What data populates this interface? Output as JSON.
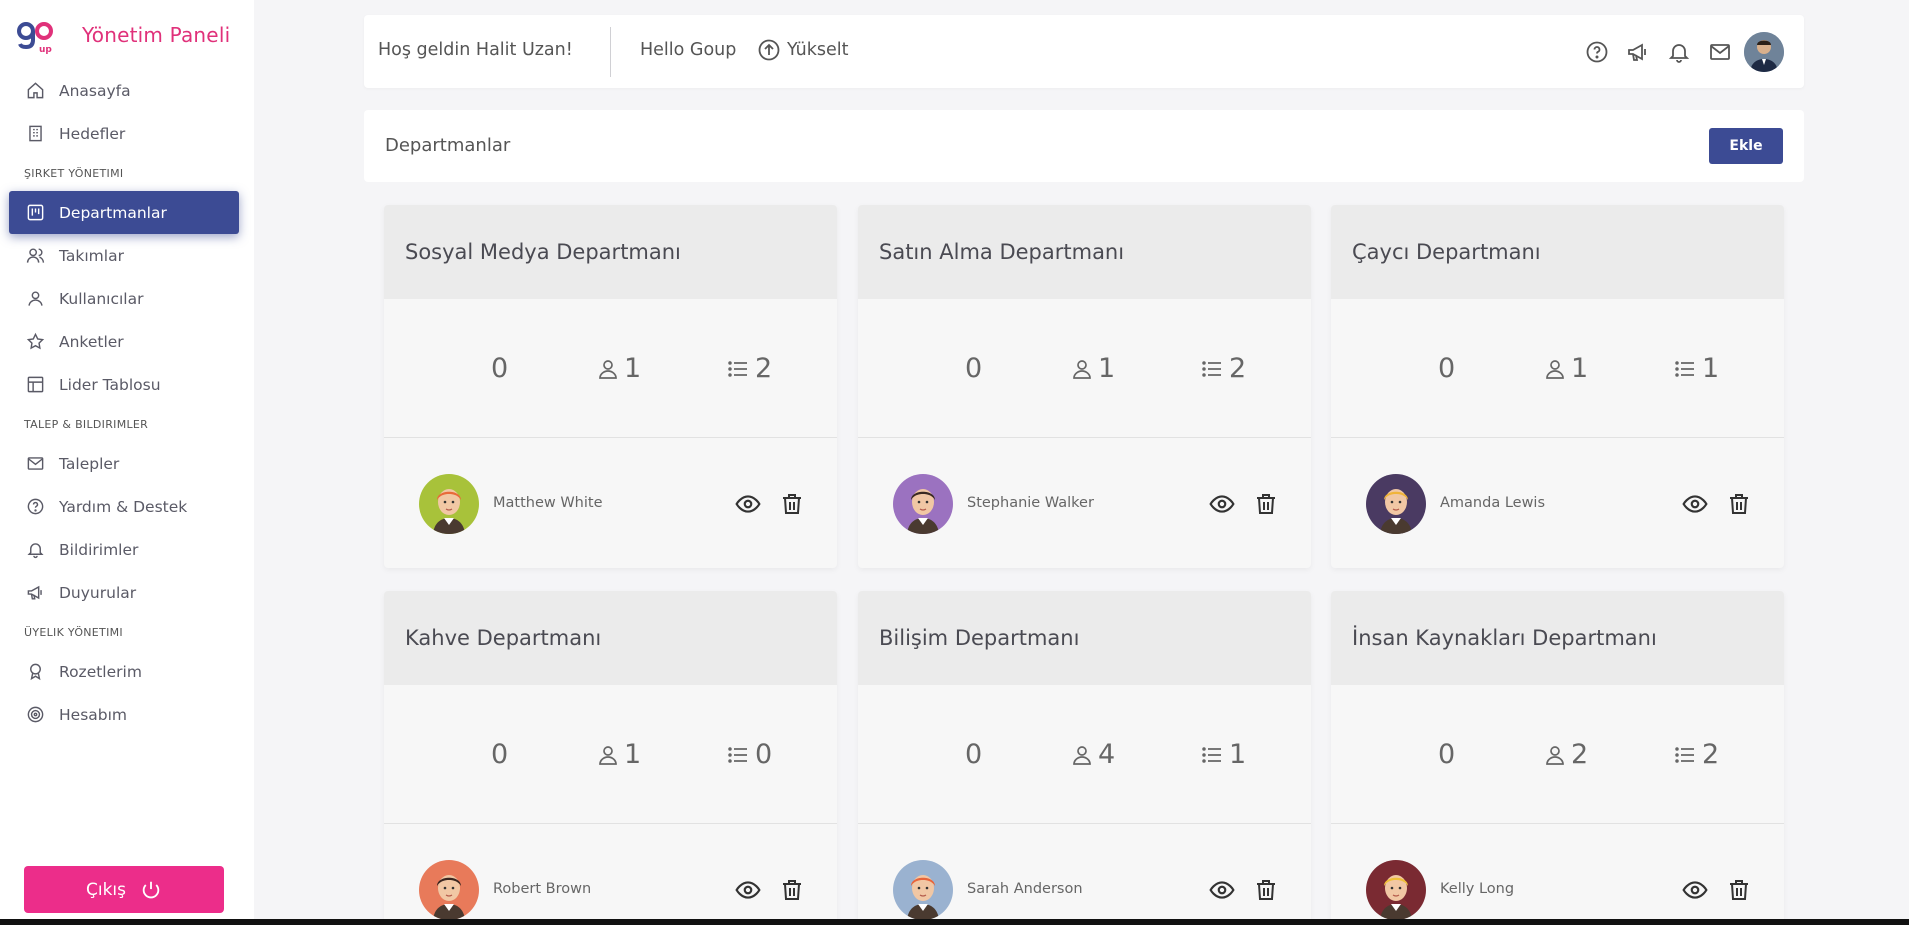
{
  "sidebar": {
    "brand_title": "Yönetim Paneli",
    "items": [
      {
        "label": "Anasayfa",
        "icon": "home-icon"
      },
      {
        "label": "Hedefler",
        "icon": "building-icon"
      }
    ],
    "section_company": "ŞIRKET YÖNETIMI",
    "company_items": [
      {
        "label": "Departmanlar",
        "icon": "board-icon",
        "active": true
      },
      {
        "label": "Takımlar",
        "icon": "users-icon"
      },
      {
        "label": "Kullanıcılar",
        "icon": "user-icon"
      },
      {
        "label": "Anketler",
        "icon": "star-icon"
      },
      {
        "label": "Lider Tablosu",
        "icon": "table-icon"
      }
    ],
    "section_requests": "TALEP & BILDIRIMLER",
    "request_items": [
      {
        "label": "Talepler",
        "icon": "mail-icon"
      },
      {
        "label": "Yardım & Destek",
        "icon": "help-icon"
      },
      {
        "label": "Bildirimler",
        "icon": "bell-icon"
      },
      {
        "label": "Duyurular",
        "icon": "megaphone-icon"
      }
    ],
    "section_membership": "ÜYELIK YÖNETIMI",
    "membership_items": [
      {
        "label": "Rozetlerim",
        "icon": "badge-icon"
      },
      {
        "label": "Hesabım",
        "icon": "target-icon"
      }
    ],
    "logout_label": "Çıkış"
  },
  "topbar": {
    "welcome": "Hoş geldin Halit Uzan!",
    "group_name": "Hello Goup",
    "upgrade_label": "Yükselt"
  },
  "page": {
    "title": "Departmanlar",
    "add_label": "Ekle"
  },
  "departments": [
    {
      "name": "Sosyal Medya Departmanı",
      "score": "0",
      "members": "1",
      "tasks": "2",
      "leader": "Matthew White",
      "avatar_bg": "#a8c23a",
      "hair": "#e86a3a"
    },
    {
      "name": "Satın Alma Departmanı",
      "score": "0",
      "members": "1",
      "tasks": "2",
      "leader": "Stephanie Walker",
      "avatar_bg": "#9b72c0",
      "hair": "#3a2a22"
    },
    {
      "name": "Çaycı Departmanı",
      "score": "0",
      "members": "1",
      "tasks": "1",
      "leader": "Amanda Lewis",
      "avatar_bg": "#4a3a62",
      "hair": "#f0b43a"
    },
    {
      "name": "Kahve Departmanı",
      "score": "0",
      "members": "1",
      "tasks": "0",
      "leader": "Robert Brown",
      "avatar_bg": "#e87a5a",
      "hair": "#3a2620"
    },
    {
      "name": "Bilişim Departmanı",
      "score": "0",
      "members": "4",
      "tasks": "1",
      "leader": "Sarah Anderson",
      "avatar_bg": "#9ab2d0",
      "hair": "#e8643a"
    },
    {
      "name": "İnsan Kaynakları Departmanı",
      "score": "0",
      "members": "2",
      "tasks": "2",
      "leader": "Kelly Long",
      "avatar_bg": "#7a2a32",
      "hair": "#f0c03a"
    }
  ]
}
